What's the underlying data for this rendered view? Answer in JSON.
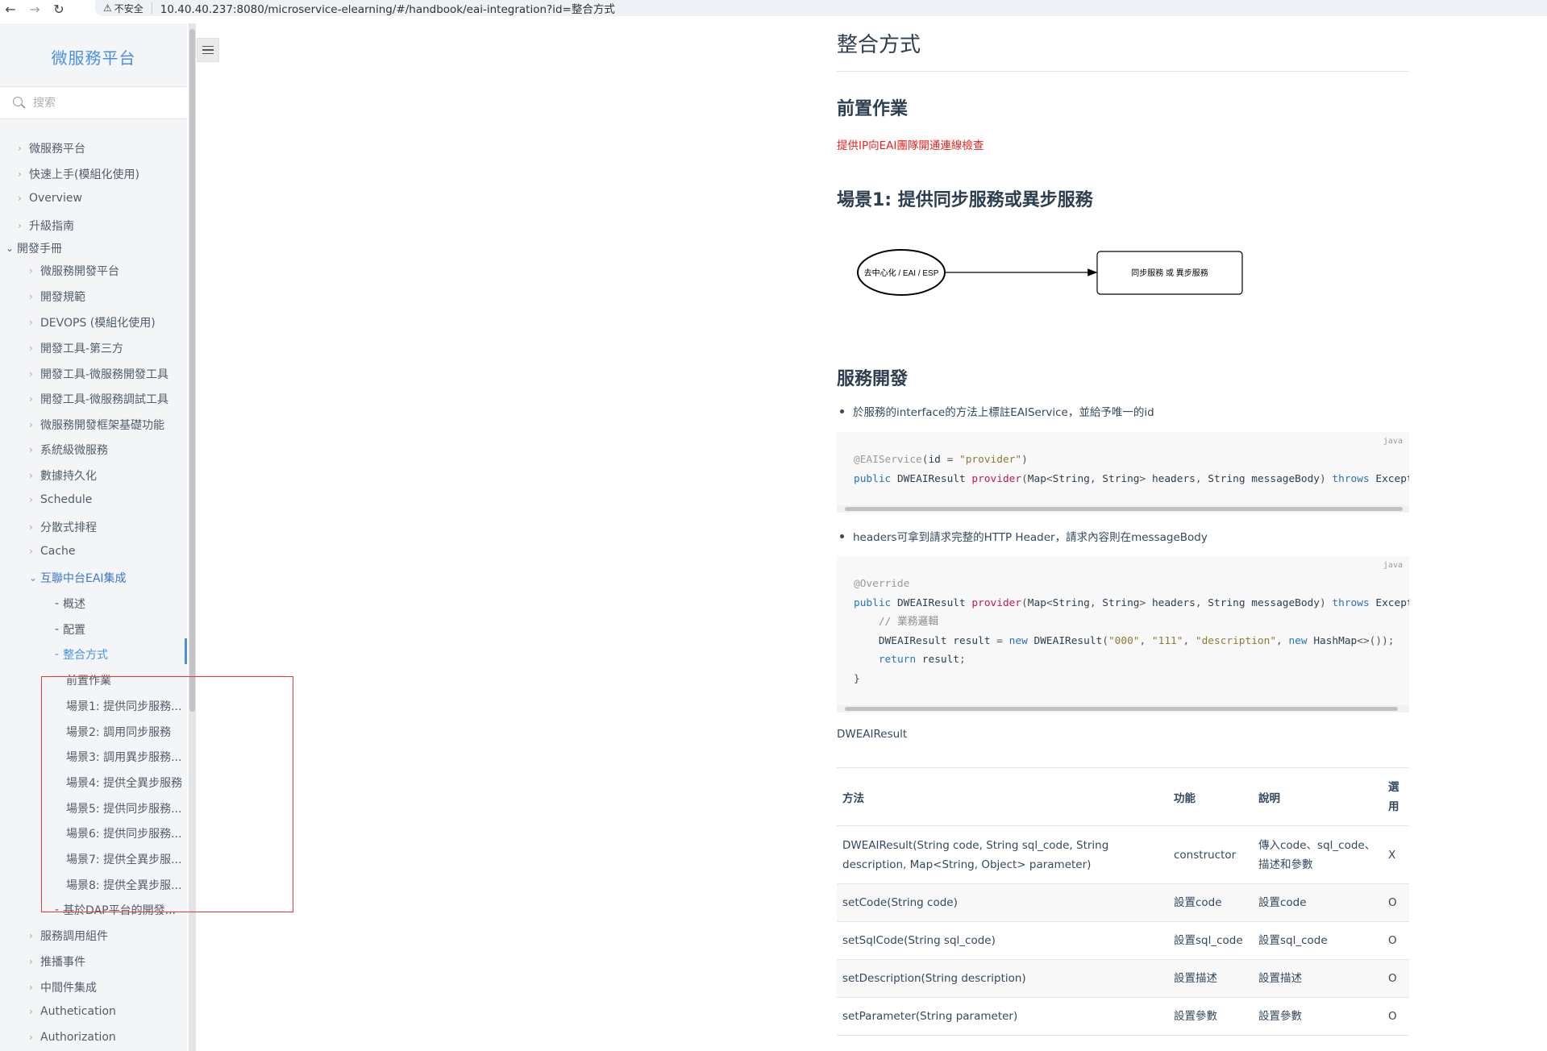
{
  "browser": {
    "security_label": "不安全",
    "url": "10.40.40.237:8080/microservice-elearning/#/handbook/eai-integration?id=整合方式"
  },
  "sidebar": {
    "app_name": "微服務平台",
    "search_placeholder": "搜索",
    "items": [
      {
        "label": "微服務平台"
      },
      {
        "label": "快速上手(模組化使用)"
      },
      {
        "label": "Overview"
      },
      {
        "label": "升級指南"
      },
      {
        "label": "開發手冊"
      },
      {
        "label": "微服務開發平台"
      },
      {
        "label": "開發規範"
      },
      {
        "label": "DEVOPS (模組化使用)"
      },
      {
        "label": "開發工具-第三方"
      },
      {
        "label": "開發工具-微服務開發工具"
      },
      {
        "label": "開發工具-微服務調試工具"
      },
      {
        "label": "微服務開發框架基礎功能"
      },
      {
        "label": "系統級微服務"
      },
      {
        "label": "數據持久化"
      },
      {
        "label": "Schedule"
      },
      {
        "label": "分散式排程"
      },
      {
        "label": "Cache"
      },
      {
        "label": "互聯中台EAI集成"
      },
      {
        "label": "概述"
      },
      {
        "label": "配置"
      },
      {
        "label": "整合方式"
      },
      {
        "label": "前置作業"
      },
      {
        "label": "場景1: 提供同步服務..."
      },
      {
        "label": "場景2: 調用同步服務"
      },
      {
        "label": "場景3: 調用異步服務..."
      },
      {
        "label": "場景4: 提供全異步服務"
      },
      {
        "label": "場景5: 提供同步服務..."
      },
      {
        "label": "場景6: 提供同步服務..."
      },
      {
        "label": "場景7: 提供全異步服..."
      },
      {
        "label": "場景8: 提供全異步服..."
      },
      {
        "label": "基於DAP平台的開發..."
      },
      {
        "label": "服務調用組件"
      },
      {
        "label": "推播事件"
      },
      {
        "label": "中間件集成"
      },
      {
        "label": "Authetication"
      },
      {
        "label": "Authorization"
      }
    ]
  },
  "content": {
    "title": "整合方式",
    "section_prereq": "前置作業",
    "prereq_text": "提供IP向EAI團隊開通連線檢查",
    "section_scene1": "場景1: 提供同步服務或異步服務",
    "diagram": {
      "left_node": "去中心化 / EAI / ESP",
      "right_node": "同步服務 或 異步服務"
    },
    "section_dev": "服務開發",
    "bullet1": "於服務的interface的方法上標註EAIService，並給予唯一的id",
    "code1_lang": "java",
    "bullet2": "headers可拿到請求完整的HTTP Header，請求內容則在messageBody",
    "code2_lang": "java",
    "result_label": "DWEAIResult",
    "table": {
      "headers": [
        "方法",
        "功能",
        "說明",
        "選用"
      ],
      "rows": [
        [
          "DWEAIResult(String code, String sql_code, String description, Map<String, Object> parameter)",
          "constructor",
          "傳入code、sql_code、描述和參數",
          "X"
        ],
        [
          "setCode(String code)",
          "設置code",
          "設置code",
          "O"
        ],
        [
          "setSqlCode(String sql_code)",
          "設置sql_code",
          "設置sql_code",
          "O"
        ],
        [
          "setDescription(String description)",
          "設置描述",
          "設置描述",
          "O"
        ],
        [
          "setParameter(String parameter)",
          "設置參數",
          "設置參數",
          "O"
        ]
      ]
    }
  },
  "colors": {
    "accent": "#4a90e2",
    "warning_text": "#e8231f",
    "highlight_box": "#e8363b"
  }
}
